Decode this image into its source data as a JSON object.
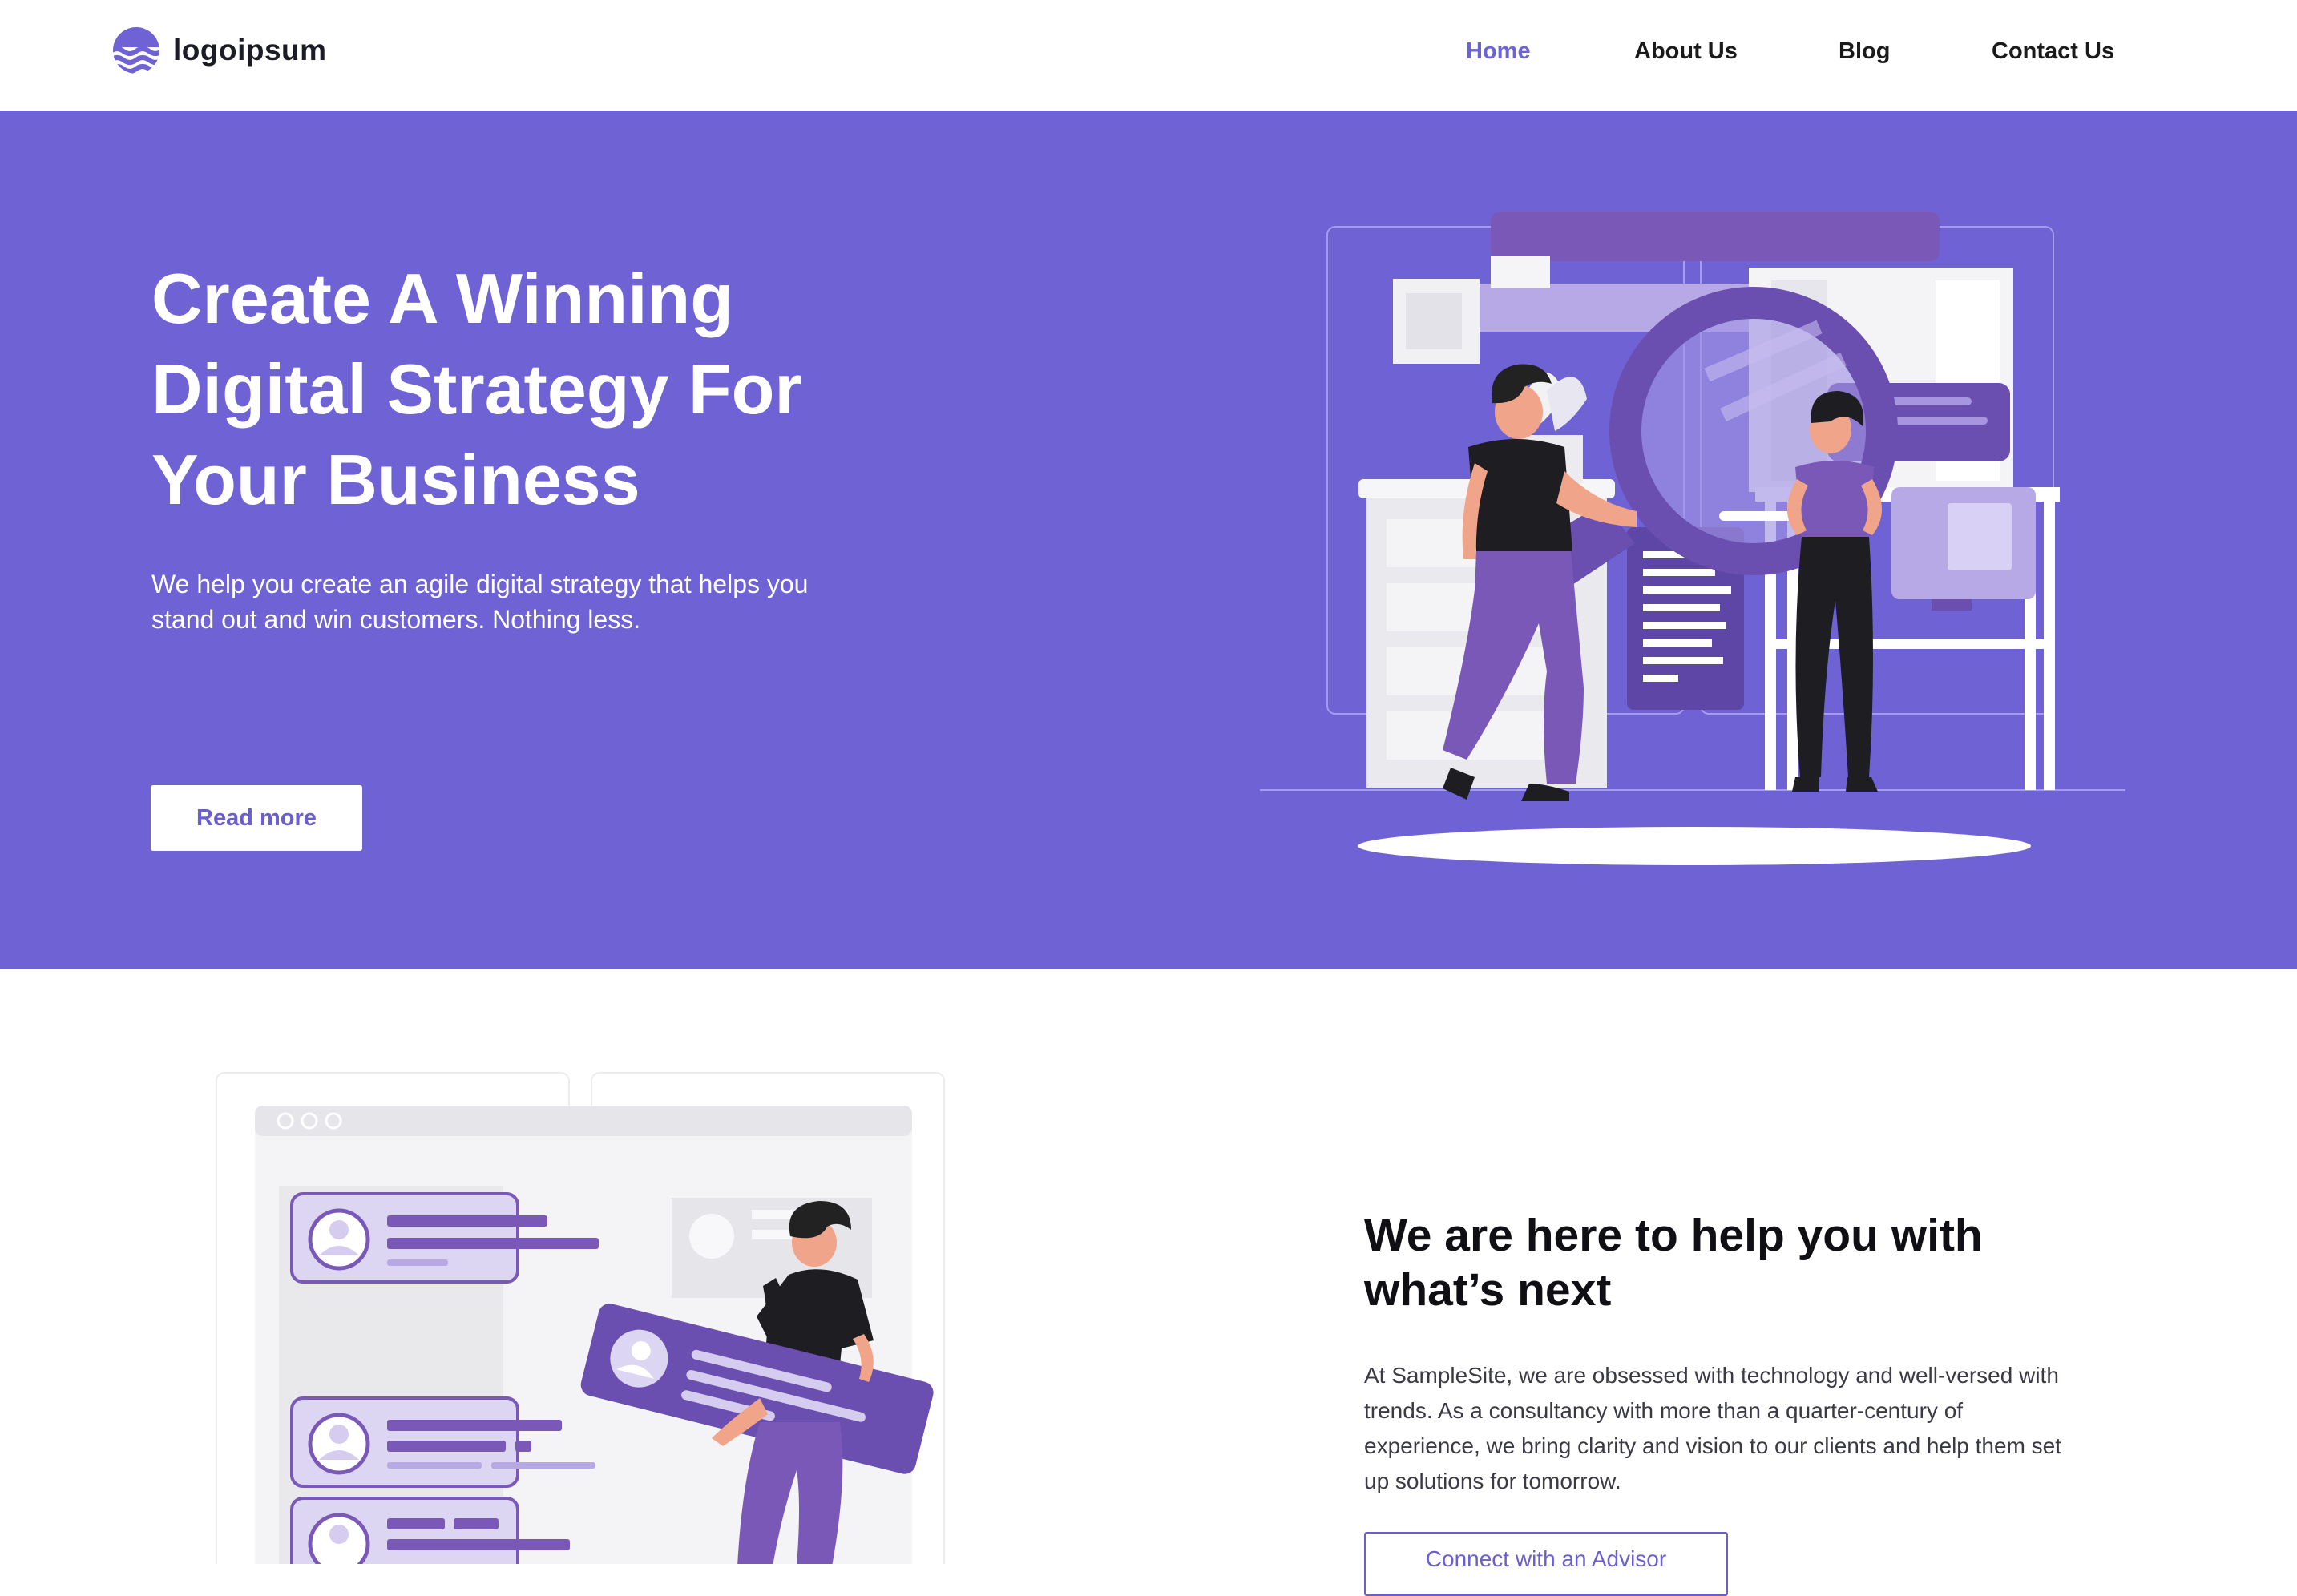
{
  "brand": {
    "name": "logoipsum",
    "accent": "#6e62d5",
    "logo_icon": "wave-circle-icon"
  },
  "nav": {
    "items": [
      {
        "label": "Home",
        "active": true
      },
      {
        "label": "About Us",
        "active": false
      },
      {
        "label": "Blog",
        "active": false
      },
      {
        "label": "Contact Us",
        "active": false
      }
    ]
  },
  "hero": {
    "title_lines": [
      "Create A Winning",
      "Digital Strategy For",
      "Your Business"
    ],
    "subtitle_lines": [
      "We help you create an agile digital strategy that helps you",
      "stand out and win customers. Nothing less."
    ],
    "cta_label": "Read more",
    "illustration": "people-with-magnifying-glass-illustration"
  },
  "section2": {
    "title_lines": [
      "We are here to help you with",
      "what’s next"
    ],
    "body_lines": [
      "At SampleSite, we are obsessed with technology and well-versed with",
      "trends. As a consultancy with more than a quarter-century of",
      "experience, we bring clarity and vision to our clients and help them set",
      "up solutions for tomorrow."
    ],
    "cta_label": "Connect with an Advisor",
    "illustration": "person-carrying-profile-card-illustration"
  }
}
